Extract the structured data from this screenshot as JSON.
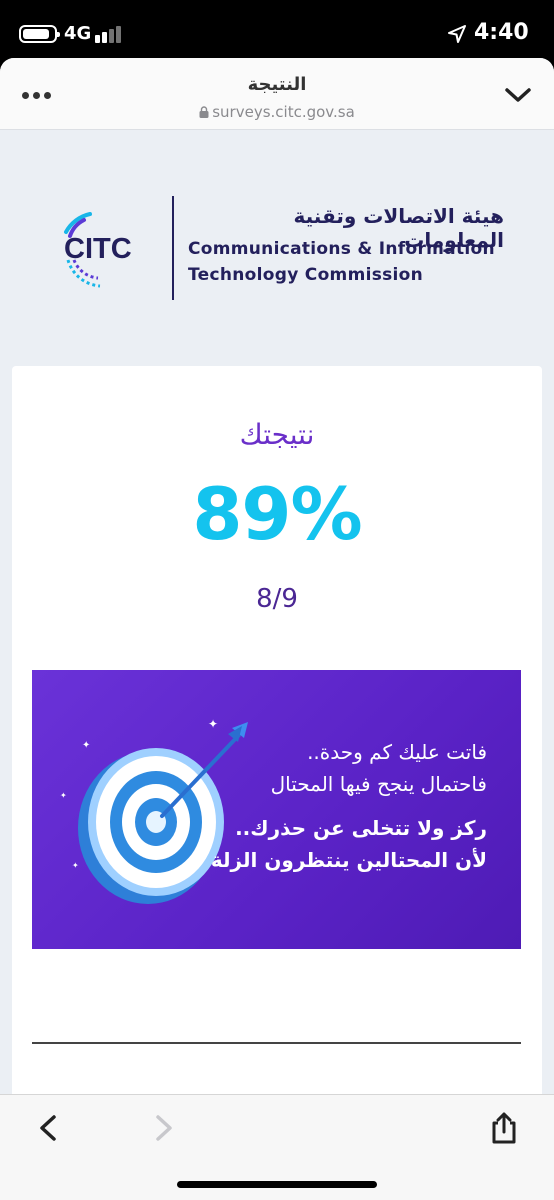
{
  "status_bar": {
    "network": "4G",
    "time": "4:40"
  },
  "header": {
    "title": "النتيجة",
    "url": "surveys.citc.gov.sa"
  },
  "logo": {
    "mark_text": "CITC",
    "name_ar": "هيئة الاتصالات وتقنية المعلومات",
    "name_en_line1": "Communications & Information",
    "name_en_line2": "Technology Commission"
  },
  "result": {
    "label": "نتيجتك",
    "percent": "89%",
    "score": "8/9"
  },
  "banner": {
    "line1": "فاتت عليك كم وحدة..",
    "line2": "فاحتمال ينجح فيها المحتال",
    "line3": "ركز ولا تتخلى عن حذرك..",
    "line4": "لأن المحتالين ينتظرون الزلة"
  },
  "colors": {
    "accent_cyan": "#14c3ee",
    "accent_purple": "#6a2fc9",
    "banner_purple": "#5a22c6",
    "brand_navy": "#23205c"
  },
  "icons": [
    "battery-icon",
    "signal-icon",
    "location-arrow-icon",
    "more-icon",
    "lock-icon",
    "chevron-down-icon",
    "back-icon",
    "forward-icon",
    "share-icon"
  ]
}
